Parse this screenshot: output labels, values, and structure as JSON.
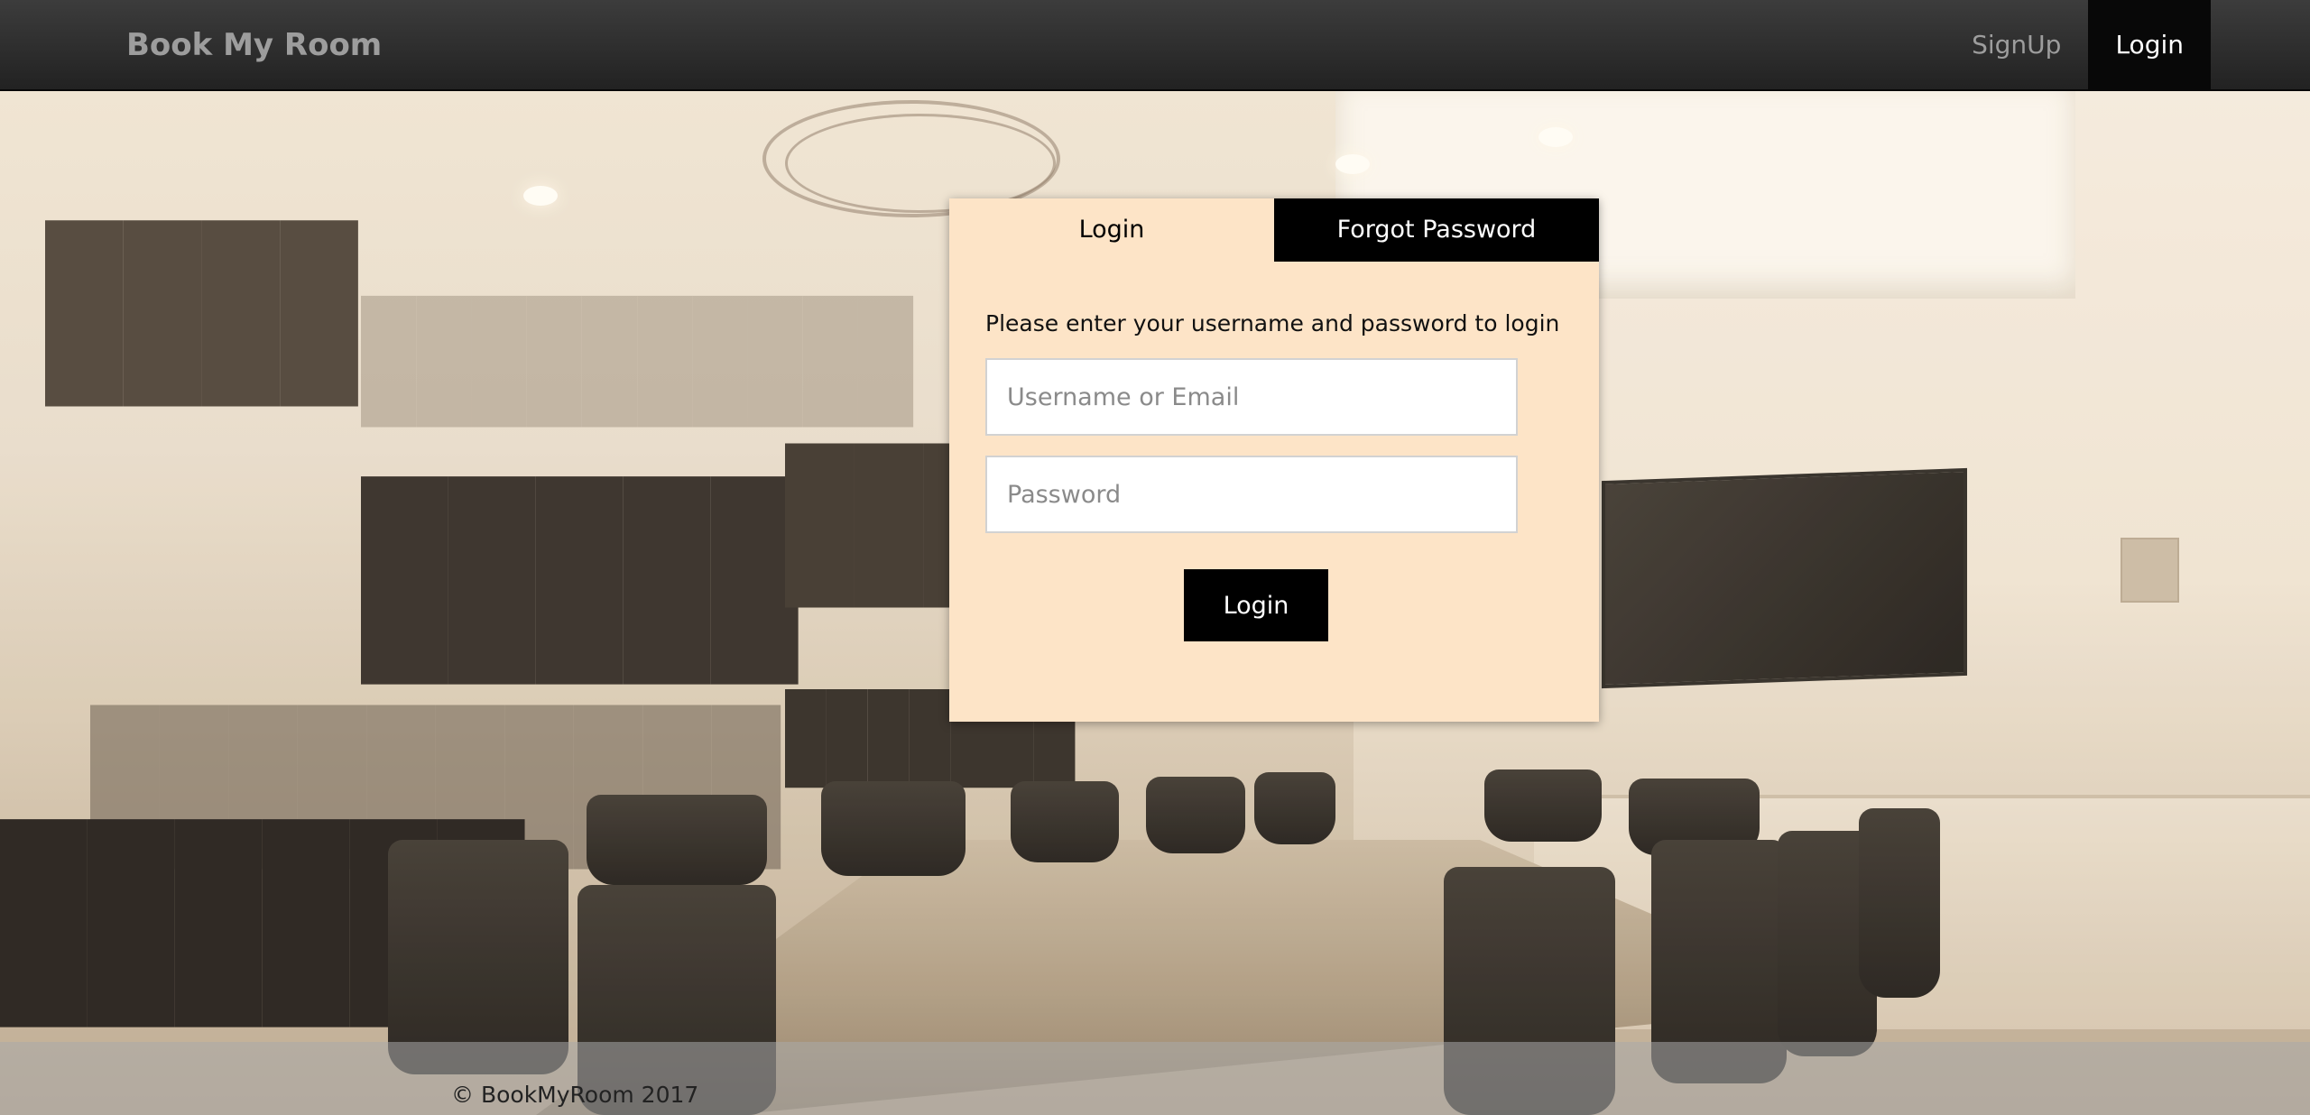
{
  "navbar": {
    "brand": "Book My Room",
    "links": [
      {
        "label": "SignUp",
        "active": false
      },
      {
        "label": "Login",
        "active": true
      }
    ]
  },
  "login_panel": {
    "tabs": [
      {
        "label": "Login",
        "active": true
      },
      {
        "label": "Forgot Password",
        "active": false
      }
    ],
    "instructions": "Please enter your username and password to login",
    "username_placeholder": "Username or Email",
    "password_placeholder": "Password",
    "submit_label": "Login"
  },
  "footer": {
    "copyright": "© BookMyRoom 2017"
  },
  "colors": {
    "panel_background": "#fde4c7",
    "navbar_background": "#222222",
    "button_background": "#000000"
  }
}
